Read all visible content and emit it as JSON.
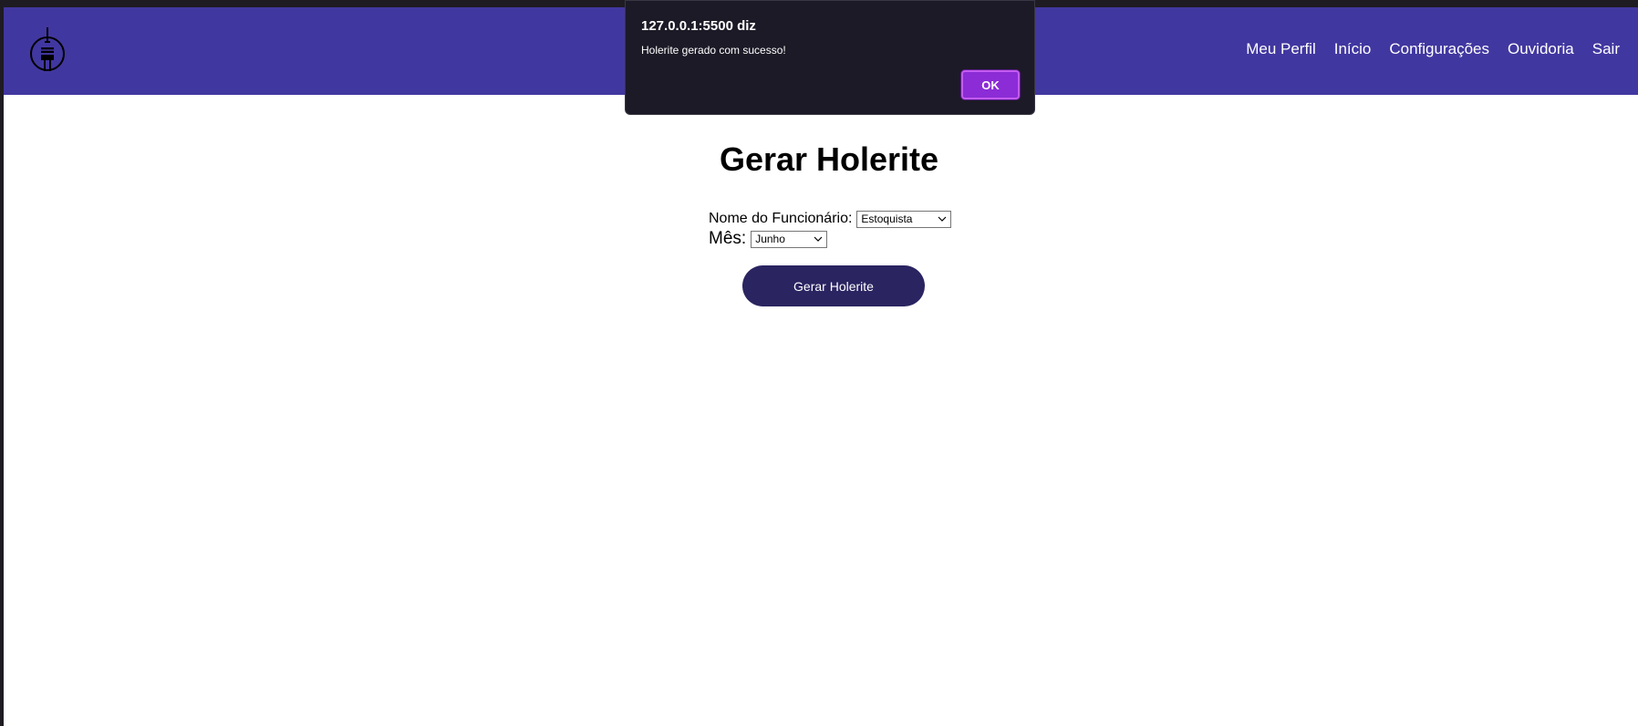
{
  "app": {
    "logo_icon": "tower-icon"
  },
  "nav": {
    "items": [
      {
        "label": "Meu Perfil"
      },
      {
        "label": "Início"
      },
      {
        "label": "Configurações"
      },
      {
        "label": "Ouvidoria"
      },
      {
        "label": "Sair"
      }
    ]
  },
  "main": {
    "title": "Gerar Holerite",
    "employee_label": "Nome do Funcionário:",
    "employee_value": "Estoquista",
    "month_label": "Mês:",
    "month_value": "Junho",
    "generate_button": "Gerar Holerite"
  },
  "dialog": {
    "title": "127.0.0.1:5500 diz",
    "message": "Holerite gerado com sucesso!",
    "ok_label": "OK"
  },
  "colors": {
    "navbar": "#4137a0",
    "button": "#2a2461",
    "dialog_bg": "#1c1a26",
    "ok_button": "#8b2cd6"
  }
}
